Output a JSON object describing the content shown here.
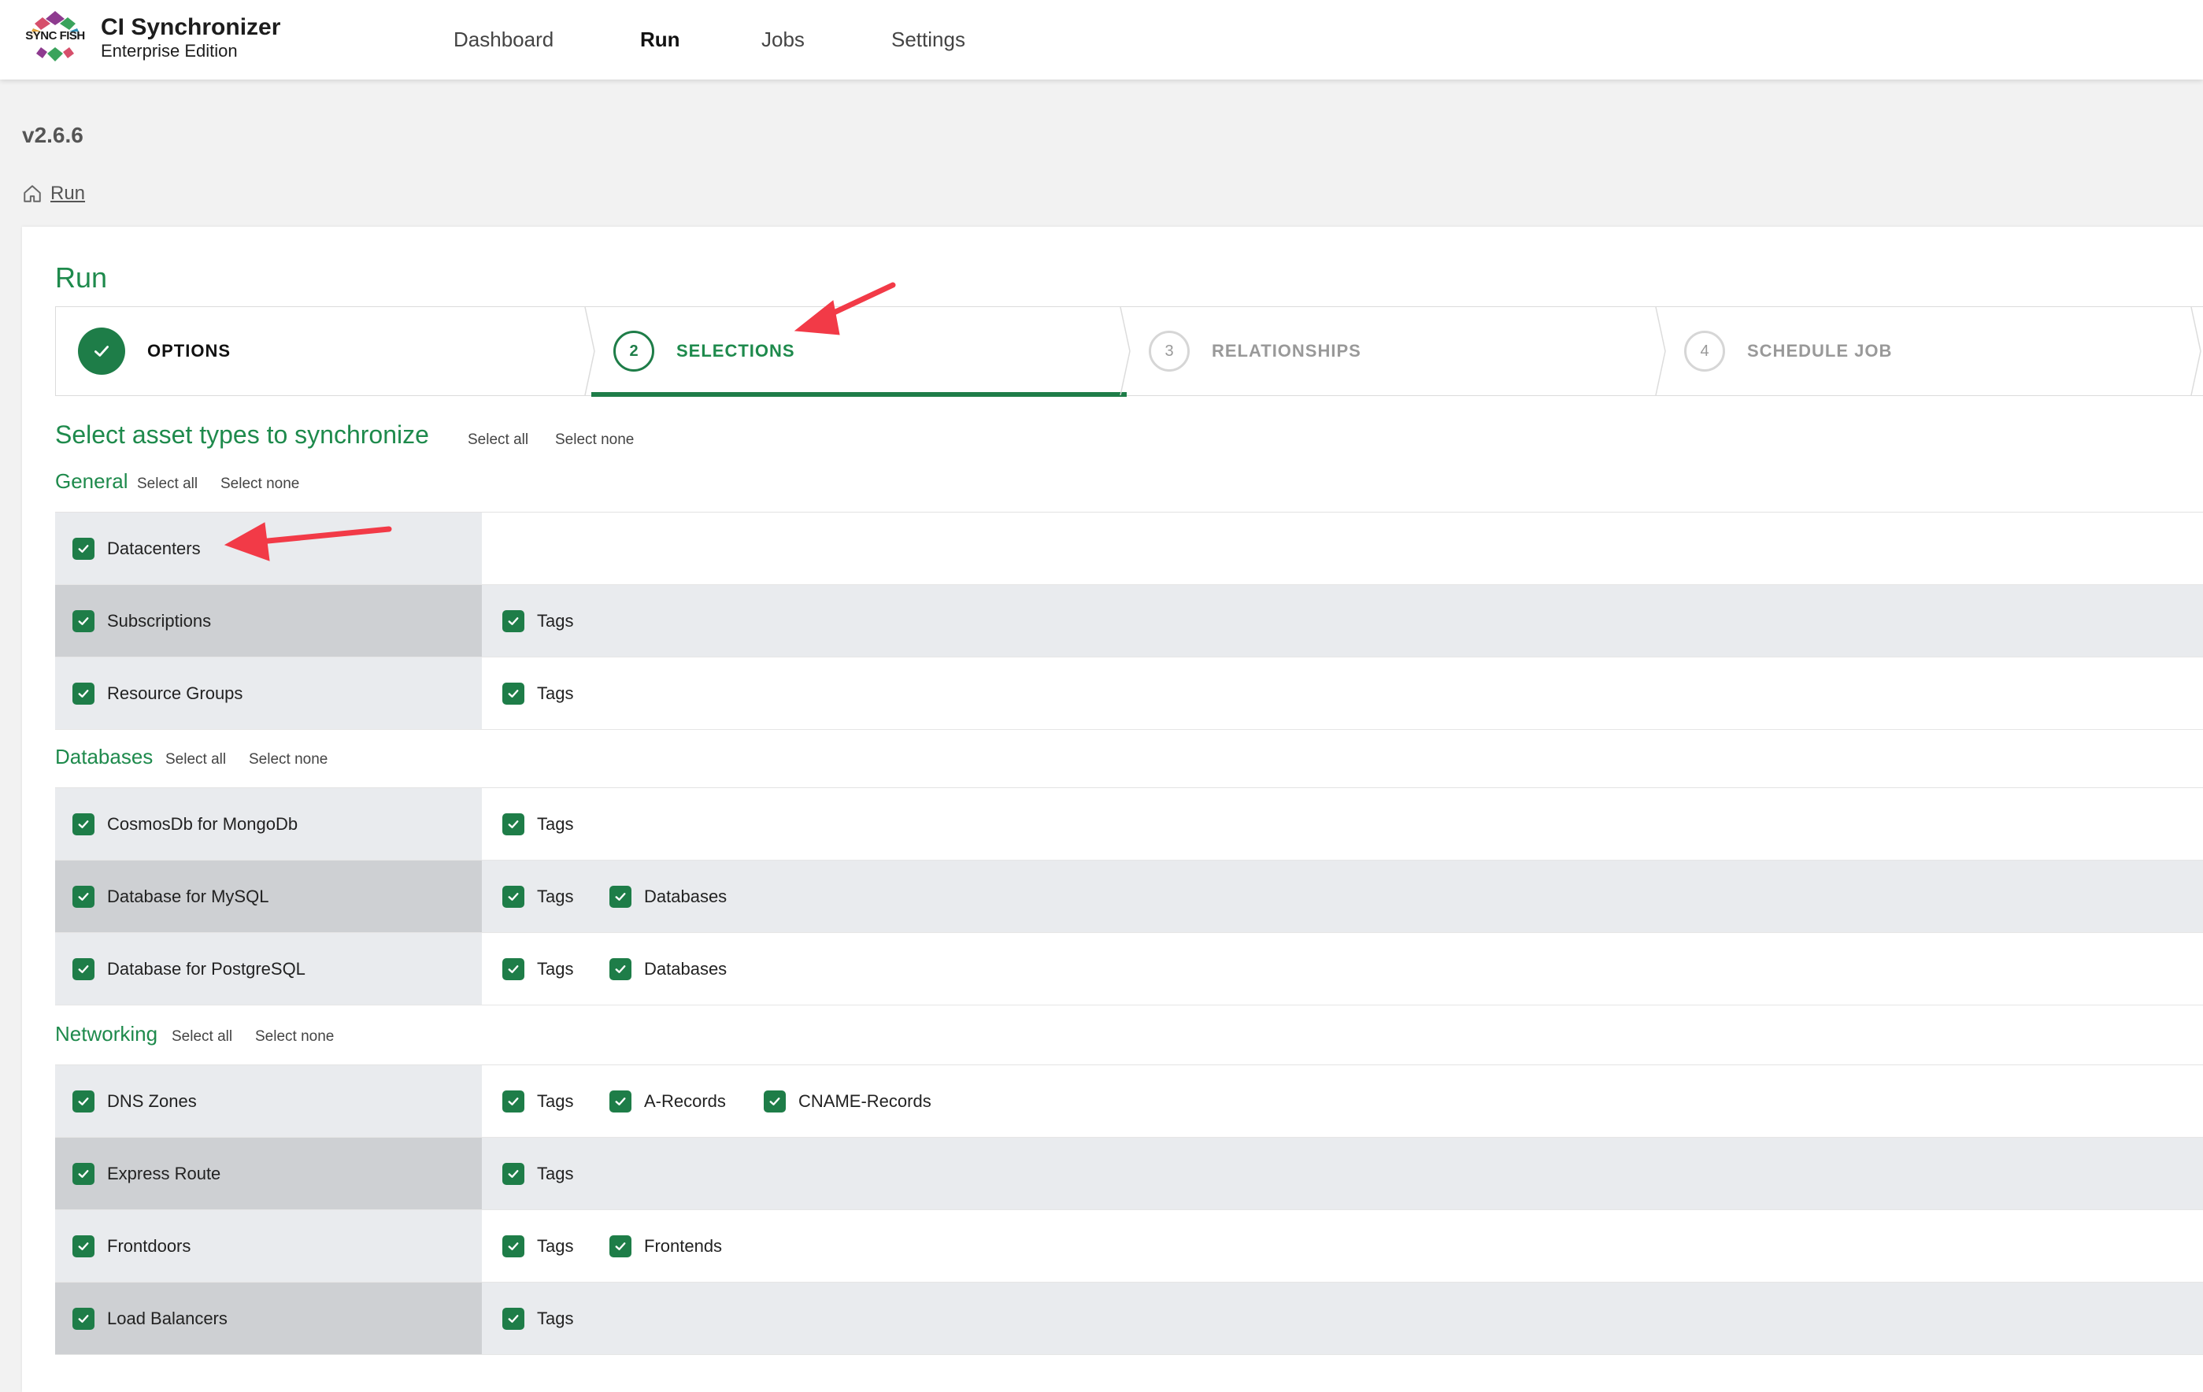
{
  "app": {
    "title": "CI Synchronizer",
    "subtitle": "Enterprise Edition",
    "logo_text": "SYNC FISH"
  },
  "nav": [
    {
      "label": "Dashboard",
      "active": false
    },
    {
      "label": "Run",
      "active": true
    },
    {
      "label": "Jobs",
      "active": false
    },
    {
      "label": "Settings",
      "active": false
    }
  ],
  "version": "v2.6.6",
  "breadcrumb": {
    "icon": "home-icon",
    "label": "Run"
  },
  "page_title": "Run",
  "stepper": [
    {
      "number": "1",
      "label": "OPTIONS",
      "state": "done"
    },
    {
      "number": "2",
      "label": "SELECTIONS",
      "state": "current"
    },
    {
      "number": "3",
      "label": "RELATIONSHIPS",
      "state": "todo"
    },
    {
      "number": "4",
      "label": "SCHEDULE JOB",
      "state": "todo"
    }
  ],
  "heading": {
    "title": "Select asset types to synchronize",
    "select_all": "Select all",
    "select_none": "Select none"
  },
  "groups": [
    {
      "name": "General",
      "select_all": "Select all",
      "select_none": "Select none",
      "rows": [
        {
          "label": "Datacenters",
          "checked": true,
          "options": []
        },
        {
          "label": "Subscriptions",
          "checked": true,
          "options": [
            {
              "label": "Tags",
              "checked": true
            }
          ]
        },
        {
          "label": "Resource Groups",
          "checked": true,
          "options": [
            {
              "label": "Tags",
              "checked": true
            }
          ]
        }
      ]
    },
    {
      "name": "Databases",
      "select_all": "Select all",
      "select_none": "Select none",
      "rows": [
        {
          "label": "CosmosDb for MongoDb",
          "checked": true,
          "options": [
            {
              "label": "Tags",
              "checked": true
            }
          ]
        },
        {
          "label": "Database for MySQL",
          "checked": true,
          "options": [
            {
              "label": "Tags",
              "checked": true
            },
            {
              "label": "Databases",
              "checked": true
            }
          ]
        },
        {
          "label": "Database for PostgreSQL",
          "checked": true,
          "options": [
            {
              "label": "Tags",
              "checked": true
            },
            {
              "label": "Databases",
              "checked": true
            }
          ]
        }
      ]
    },
    {
      "name": "Networking",
      "select_all": "Select all",
      "select_none": "Select none",
      "rows": [
        {
          "label": "DNS Zones",
          "checked": true,
          "options": [
            {
              "label": "Tags",
              "checked": true
            },
            {
              "label": "A-Records",
              "checked": true
            },
            {
              "label": "CNAME-Records",
              "checked": true
            }
          ]
        },
        {
          "label": "Express Route",
          "checked": true,
          "options": [
            {
              "label": "Tags",
              "checked": true
            }
          ]
        },
        {
          "label": "Frontdoors",
          "checked": true,
          "options": [
            {
              "label": "Tags",
              "checked": true
            },
            {
              "label": "Frontends",
              "checked": true
            }
          ]
        },
        {
          "label": "Load Balancers",
          "checked": true,
          "options": [
            {
              "label": "Tags",
              "checked": true
            }
          ]
        }
      ]
    }
  ],
  "colors": {
    "accent_green": "#1e8a4c",
    "checkbox_green": "#1e7d48",
    "annotation_red": "#f23a47"
  }
}
